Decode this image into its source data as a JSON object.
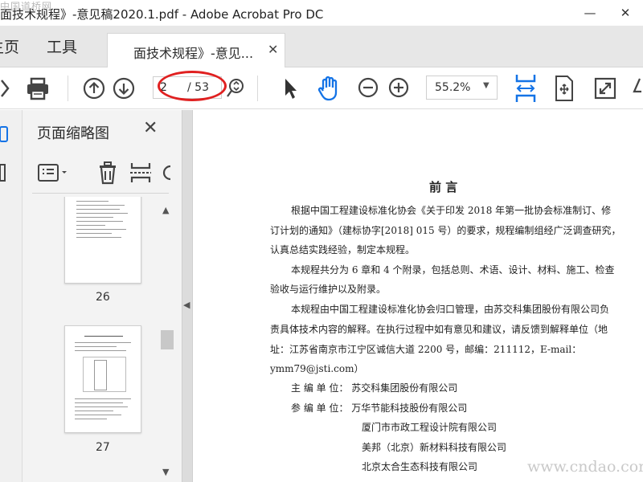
{
  "window": {
    "title": "面技术规程》-意见稿2020.1.pdf - Adobe Acrobat Pro DC",
    "minimize": "—",
    "close": "✕"
  },
  "watermark_top": "中国道桥网",
  "watermark_bottom": "www.cndao.com",
  "tabs": {
    "home": "主页",
    "tools": "工具",
    "document": "面技术规程》-意见...",
    "document_close": "✕"
  },
  "toolbar": {
    "page_current": "2",
    "page_total": "/ 53",
    "zoom": "55.2%",
    "zoom_caret": "▼",
    "icons": [
      "printer-icon",
      "page-up-icon",
      "page-down-icon",
      "select-arrow-icon",
      "hand-tool-icon",
      "zoom-out-icon",
      "zoom-in-icon",
      "fit-width-icon",
      "page-view-icon",
      "fullscreen-icon"
    ]
  },
  "panel": {
    "title": "页面缩略图",
    "close": "✕",
    "thumbnails": [
      {
        "page": "26"
      },
      {
        "page": "27"
      }
    ]
  },
  "document": {
    "heading": "前 言",
    "lines": [
      "根据中国工程建设标准化协会《关于印发 2018 年第一批协会标准制订、修",
      "订计划的通知》（建标协字[2018] 015 号）的要求，规程编制组经广泛调查研究，",
      "认真总结实践经验，制定本规程。",
      "本规程共分为 6 章和 4 个附录，包括总则、术语、设计、材料、施工、检查",
      "验收与运行维护以及附录。",
      "本规程由中国工程建设标准化协会归口管理，由苏交科集团股份有限公司负",
      "责具体技术内容的解释。在执行过程中如有意见和建议，请反馈到解释单位（地",
      "址：江苏省南京市江宁区诚信大道 2200 号，邮编：211112，E-mail：",
      "ymm79@jsti.com）",
      "主 编 单 位：  苏交科集团股份有限公司",
      "参 编 单 位：  万华节能科技股份有限公司",
      "厦门市市政工程设计院有限公司",
      "美邦（北京）新材料科技有限公司",
      "北京太合生态科技有限公司"
    ]
  },
  "colors": {
    "accent": "#1473e6",
    "highlight_ring": "#e02020",
    "tabbar": "#e7e7e7",
    "panel": "#f3f3f3"
  }
}
